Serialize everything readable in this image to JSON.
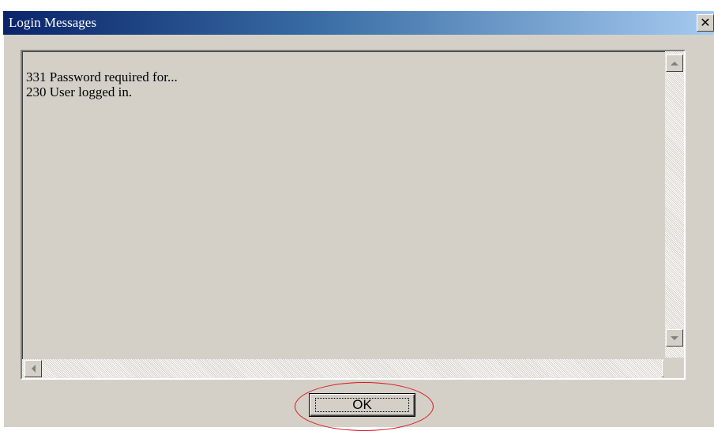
{
  "window": {
    "title": "Login Messages",
    "close_symbol": "✕"
  },
  "messages": {
    "lines": [
      "331 Password required for...",
      "230 User logged in."
    ]
  },
  "buttons": {
    "ok_label": "OK"
  },
  "colors": {
    "dialog_face": "#d4d0c8",
    "titlebar_start": "#0a246a",
    "titlebar_end": "#a6caf0",
    "highlight": "#d9141e"
  },
  "icons": {
    "close": "close-icon",
    "scroll_up": "arrow-up-icon",
    "scroll_down": "arrow-down-icon",
    "scroll_left": "arrow-left-icon",
    "scroll_right": "arrow-right-icon"
  }
}
